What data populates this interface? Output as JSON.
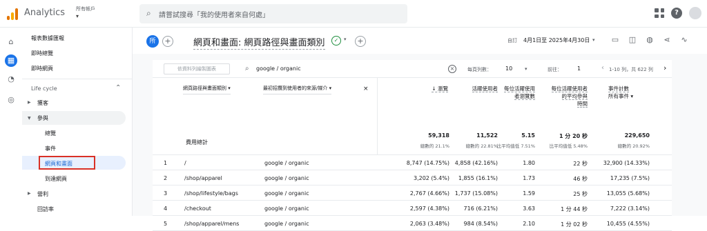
{
  "topbar": {
    "app_name": "Analytics",
    "account_label": "所有帳戶",
    "search_placeholder": "請嘗試搜尋「我的使用者來自何處」",
    "help_label": "?"
  },
  "rail": {
    "icons": [
      "home-icon",
      "reports-icon",
      "explore-icon",
      "advertising-icon"
    ],
    "glyphs": [
      "⌂",
      "▦",
      "◔",
      "◎"
    ]
  },
  "nav": {
    "items": {
      "snapshot": "報表數據匯報",
      "realtime_overview": "即時總覽",
      "realtime_pages": "即時網頁",
      "lifecycle": "Life cycle",
      "acquisition": "獲客",
      "engagement": "參與",
      "overview": "總覽",
      "events": "事件",
      "pages_screens": "網頁和畫面",
      "landing_page": "到達網頁",
      "monetization": "營利",
      "retention": "回訪率"
    },
    "highlight_color": "#e8f0fe",
    "selected_border": "#d93025"
  },
  "header": {
    "badge": "所",
    "title": "網頁和畫面: 網頁路徑與畫面類別",
    "check": "✓",
    "date_label": "自訂",
    "date_value": "4月1日至 2025年4月30日"
  },
  "table_controls": {
    "make_chart": "依資料列繪製圖表",
    "search_value": "google / organic",
    "rows_label": "每頁列數：",
    "rows_value": "10",
    "goto_label": "前往：",
    "goto_value": "1",
    "range": "1-10 列，共 622 列"
  },
  "table": {
    "dim1": "網頁路徑與畫面類別",
    "dim2": "最初招攬到使用者的來源/媒介",
    "total_label": "費用總計",
    "columns": [
      {
        "label": "↓ 瀏覽",
        "total": "59,318",
        "sub": "總數的 21.1%"
      },
      {
        "label": "活躍使用者",
        "total": "11,522",
        "sub": "總數的 22.81%"
      },
      {
        "label": "每位活躍使用者瀏覽數",
        "total": "5.15",
        "sub": "比平均值低 7.51%"
      },
      {
        "label": "每位活躍使用者的平均參與時間",
        "total": "1 分 20 秒",
        "sub": "比平均值低 5.48%"
      },
      {
        "label": "事件計數 所有事件",
        "total": "229,650",
        "sub": "總數的 20.92%"
      }
    ],
    "col_labels": {
      "views": "↓ 瀏覽",
      "active_users": "活躍使用者",
      "views_per_user_1": "每位活躍使用",
      "views_per_user_2": "者瀏覽數",
      "eng_time_1": "每位活躍使用者",
      "eng_time_2": "的平均參與",
      "eng_time_3": "時間",
      "events_1": "事件計數",
      "events_2": "所有事件"
    },
    "rows": [
      {
        "n": "1",
        "path": "/",
        "source": "google / organic",
        "views": "8,747 (14.75%)",
        "users": "4,858 (42.16%)",
        "vpu": "1.80",
        "time": "22 秒",
        "events": "32,900 (14.33%)"
      },
      {
        "n": "2",
        "path": "/shop/apparel",
        "source": "google / organic",
        "views": "3,202 (5.4%)",
        "users": "1,855 (16.1%)",
        "vpu": "1.73",
        "time": "46 秒",
        "events": "17,235 (7.5%)"
      },
      {
        "n": "3",
        "path": "/shop/lifestyle/bags",
        "source": "google / organic",
        "views": "2,767 (4.66%)",
        "users": "1,737 (15.08%)",
        "vpu": "1.59",
        "time": "25 秒",
        "events": "13,055 (5.68%)"
      },
      {
        "n": "4",
        "path": "/checkout",
        "source": "google / organic",
        "views": "2,597 (4.38%)",
        "users": "716 (6.21%)",
        "vpu": "3.63",
        "time": "1 分 44 秒",
        "events": "7,222 (3.14%)"
      },
      {
        "n": "5",
        "path": "/shop/apparel/mens",
        "source": "google / organic",
        "views": "2,063 (3.48%)",
        "users": "984 (8.54%)",
        "vpu": "2.10",
        "time": "1 分 02 秒",
        "events": "10,455 (4.55%)"
      }
    ]
  }
}
